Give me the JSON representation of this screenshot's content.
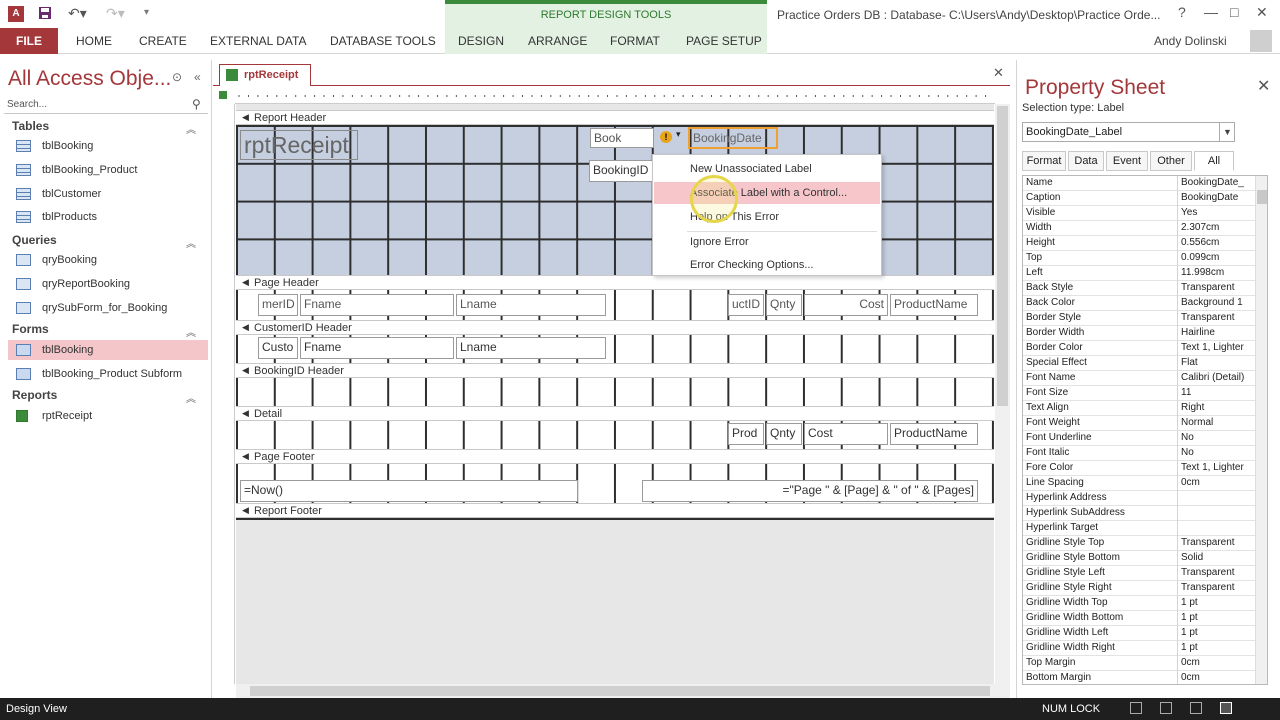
{
  "title_bar": {
    "context_group": "REPORT DESIGN TOOLS",
    "document_title": "Practice Orders DB : Database- C:\\Users\\Andy\\Desktop\\Practice Orde...",
    "help": "?",
    "minimize": "—",
    "restore": "□",
    "close": "✕"
  },
  "ribbon": {
    "file": "FILE",
    "tabs": [
      "HOME",
      "CREATE",
      "EXTERNAL DATA",
      "DATABASE TOOLS"
    ],
    "context_tabs": [
      "DESIGN",
      "ARRANGE",
      "FORMAT",
      "PAGE SETUP"
    ],
    "user": "Andy Dolinski"
  },
  "nav": {
    "title": "All Access Obje...",
    "search_placeholder": "Search...",
    "groups": {
      "tables": "Tables",
      "queries": "Queries",
      "forms": "Forms",
      "reports": "Reports"
    },
    "tables": [
      "tblBooking",
      "tblBooking_Product",
      "tblCustomer",
      "tblProducts"
    ],
    "queries": [
      "qryBooking",
      "qryReportBooking",
      "qrySubForm_for_Booking"
    ],
    "forms": [
      "tblBooking",
      "tblBooking_Product Subform"
    ],
    "reports": [
      "rptReceipt"
    ]
  },
  "document": {
    "tab": "rptReceipt",
    "close": "✕",
    "sections": {
      "report_header": "Report Header",
      "page_header": "Page Header",
      "customer_header": "CustomerID Header",
      "booking_header": "BookingID Header",
      "detail": "Detail",
      "page_footer": "Page Footer",
      "report_footer": "Report Footer"
    },
    "controls": {
      "title": "rptReceipt",
      "book_label": "Book",
      "booking_date": "BookingDate",
      "booking_id": "BookingID",
      "ph_customer": "merID",
      "ph_fname": "Fname",
      "ph_lname": "Lname",
      "ph_product": "uctID",
      "ph_qnty": "Qnty",
      "ph_cost": "Cost",
      "ph_productname": "ProductName",
      "ch_custo": "Custo",
      "ch_fname": "Fname",
      "ch_lname": "Lname",
      "d_prod": "Prod",
      "d_qnty": "Qnty",
      "d_cost": "Cost",
      "d_productname": "ProductName",
      "pf_now": "=Now()",
      "pf_pages": "=\"Page \" & [Page] & \" of \" & [Pages]"
    },
    "context_menu": [
      "New Unassociated Label",
      "Associate Label with a Control...",
      "Help on This Error",
      "Ignore Error",
      "Error Checking Options..."
    ]
  },
  "property_sheet": {
    "title": "Property Sheet",
    "close": "✕",
    "selection_type": "Selection type:  Label",
    "selected": "BookingDate_Label",
    "tabs": [
      "Format",
      "Data",
      "Event",
      "Other",
      "All"
    ],
    "rows": [
      [
        "Name",
        "BookingDate_"
      ],
      [
        "Caption",
        "BookingDate"
      ],
      [
        "Visible",
        "Yes"
      ],
      [
        "Width",
        "2.307cm"
      ],
      [
        "Height",
        "0.556cm"
      ],
      [
        "Top",
        "0.099cm"
      ],
      [
        "Left",
        "11.998cm"
      ],
      [
        "Back Style",
        "Transparent"
      ],
      [
        "Back Color",
        "Background 1"
      ],
      [
        "Border Style",
        "Transparent"
      ],
      [
        "Border Width",
        "Hairline"
      ],
      [
        "Border Color",
        "Text 1, Lighter"
      ],
      [
        "Special Effect",
        "Flat"
      ],
      [
        "Font Name",
        "Calibri (Detail)"
      ],
      [
        "Font Size",
        "11"
      ],
      [
        "Text Align",
        "Right"
      ],
      [
        "Font Weight",
        "Normal"
      ],
      [
        "Font Underline",
        "No"
      ],
      [
        "Font Italic",
        "No"
      ],
      [
        "Fore Color",
        "Text 1, Lighter"
      ],
      [
        "Line Spacing",
        "0cm"
      ],
      [
        "Hyperlink Address",
        ""
      ],
      [
        "Hyperlink SubAddress",
        ""
      ],
      [
        "Hyperlink Target",
        ""
      ],
      [
        "Gridline Style Top",
        "Transparent"
      ],
      [
        "Gridline Style Bottom",
        "Solid"
      ],
      [
        "Gridline Style Left",
        "Transparent"
      ],
      [
        "Gridline Style Right",
        "Transparent"
      ],
      [
        "Gridline Width Top",
        "1 pt"
      ],
      [
        "Gridline Width Bottom",
        "1 pt"
      ],
      [
        "Gridline Width Left",
        "1 pt"
      ],
      [
        "Gridline Width Right",
        "1 pt"
      ],
      [
        "Top Margin",
        "0cm"
      ],
      [
        "Bottom Margin",
        "0cm"
      ]
    ]
  },
  "status_bar": {
    "mode": "Design View",
    "num_lock": "NUM LOCK"
  },
  "colors": {
    "accent": "#a4373a",
    "context": "#e2f1e2",
    "section_header": "#c6cfe0"
  }
}
